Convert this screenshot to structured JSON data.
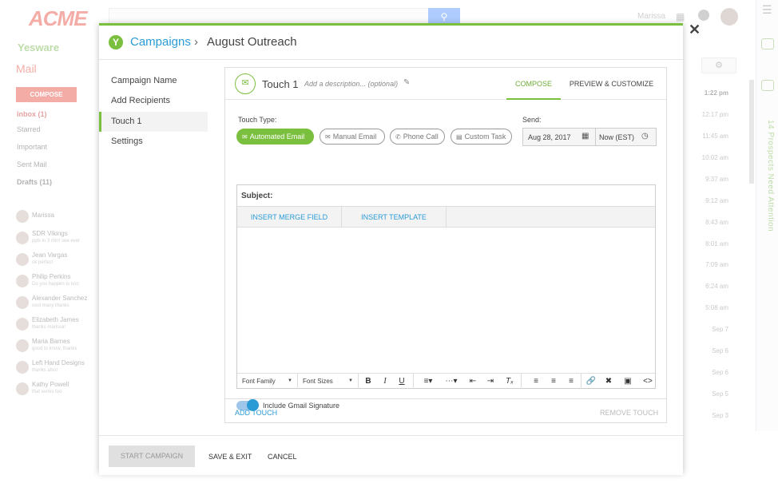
{
  "background": {
    "brand": "ACME",
    "user_name": "Marissa",
    "yesware_label": "Yesware",
    "mail_label": "Mail",
    "compose_label": "COMPOSE",
    "nav": [
      "Inbox (1)",
      "Starred",
      "Important",
      "Sent Mail",
      "Drafts (11)"
    ],
    "chat_user": "Marissa",
    "chats": [
      {
        "name": "SDR Vikings",
        "status": "ppls in 3 min! see ever"
      },
      {
        "name": "Jean Vargas",
        "status": "ok perfect"
      },
      {
        "name": "Philip Perkins",
        "status": "Do you happen to kno"
      },
      {
        "name": "Alexander Sanchez",
        "status": "cool many thanks"
      },
      {
        "name": "Elizabeth James",
        "status": "thanks marissa!"
      },
      {
        "name": "Maria Barnes",
        "status": "good to know, thanks"
      },
      {
        "name": "Left Hand Designs",
        "status": "thanks also!"
      },
      {
        "name": "Kathy Powell",
        "status": "that works too"
      }
    ],
    "times": [
      "1:22 pm",
      "12:17 pm",
      "11:45 am",
      "10:02 am",
      "9:37 am",
      "9:12 am",
      "8:43 am",
      "8:01 am",
      "7:09 am",
      "6:24 am",
      "5:08 am",
      "Sep 7",
      "Sep 6",
      "Sep 6",
      "Sep 5",
      "Sep 3"
    ],
    "side_panel_text": "14 Prospects Need Attention"
  },
  "modal": {
    "breadcrumb_link": "Campaigns",
    "breadcrumb_sep": "›",
    "breadcrumb_current": "August Outreach",
    "sidebar": [
      "Campaign Name",
      "Add Recipients",
      "Touch 1",
      "Settings"
    ],
    "touch": {
      "title": "Touch 1",
      "desc_placeholder": "Add a description... (optional)",
      "tabs": [
        "COMPOSE",
        "PREVIEW & CUSTOMIZE"
      ],
      "touch_type_label": "Touch Type:",
      "types": [
        "Automated Email",
        "Manual Email",
        "Phone Call",
        "Custom Task"
      ],
      "send_label": "Send:",
      "send_date": "Aug 28, 2017",
      "send_time": "Now (EST)",
      "subject_label": "Subject:",
      "insert_merge": "INSERT MERGE FIELD",
      "insert_template": "INSERT TEMPLATE",
      "font_family": "Font Family",
      "font_sizes": "Font Sizes",
      "signature_label": "Include Gmail Signature",
      "signature_on": true,
      "add_touch": "ADD TOUCH",
      "remove_touch": "REMOVE TOUCH"
    },
    "footer": {
      "start": "START CAMPAIGN",
      "save": "SAVE & EXIT",
      "cancel": "CANCEL"
    }
  },
  "colors": {
    "accent_green": "#7bbf3e",
    "link_blue": "#2a9bd5",
    "brand_red": "#e8493c"
  }
}
